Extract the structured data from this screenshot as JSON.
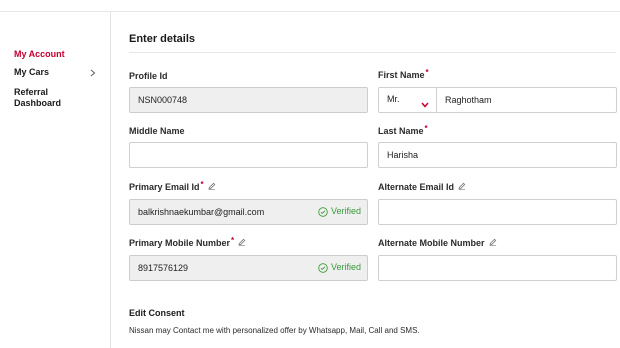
{
  "sidebar": {
    "items": [
      {
        "label": "My Account"
      },
      {
        "label": "My Cars"
      },
      {
        "label": "Referral"
      },
      {
        "label": "Dashboard"
      }
    ]
  },
  "main": {
    "section_title": "Enter details",
    "profile_id": {
      "label": "Profile Id",
      "value": "NSN000748"
    },
    "first_name": {
      "label": "First Name",
      "salutation": "Mr.",
      "value": "Raghotham"
    },
    "middle_name": {
      "label": "Middle Name",
      "value": ""
    },
    "last_name": {
      "label": "Last Name",
      "value": "Harisha"
    },
    "primary_email": {
      "label": "Primary Email Id",
      "value": "balkrishnaekumbar@gmail.com",
      "status": "Verified"
    },
    "alternate_email": {
      "label": "Alternate Email Id",
      "value": ""
    },
    "primary_mobile": {
      "label": "Primary Mobile Number",
      "value": "8917576129",
      "status": "Verified"
    },
    "alternate_mobile": {
      "label": "Alternate Mobile Number",
      "value": ""
    },
    "required_mark": "*"
  },
  "consent": {
    "title": "Edit Consent",
    "text": "Nissan may Contact me with personalized offer by Whatsapp, Mail, Call and SMS."
  },
  "colors": {
    "accent": "#c3002f",
    "verified": "#3b9a3b",
    "readonly_bg": "#efefef"
  }
}
